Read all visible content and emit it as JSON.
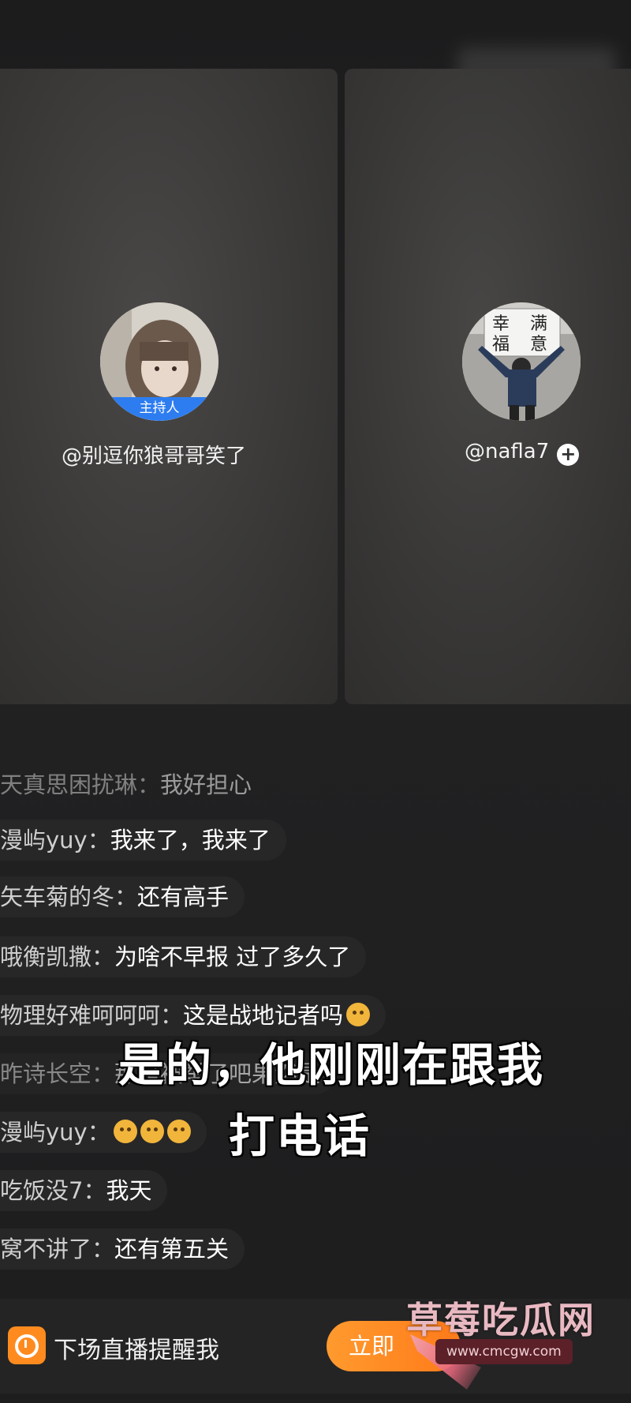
{
  "panels": {
    "left": {
      "name": "@别逗你狼哥哥笑了",
      "badge": "主持人"
    },
    "right": {
      "name": "@nafla7",
      "follow_icon": "plus-circle-icon",
      "sign_text": "幸满福意"
    }
  },
  "chat": [
    {
      "user": "天真思困扰琳：",
      "text": "我好担心"
    },
    {
      "user": "漫屿yuy：",
      "text": "我来了，我来了"
    },
    {
      "user": "矢车菊的冬：",
      "text": "还有高手"
    },
    {
      "user": "哦衡凯撒：",
      "text": "为啥不早报 过了多久了"
    },
    {
      "user": "物理好难呵呵呵：",
      "text": "这是战地记者吗"
    },
    {
      "user": "昨诗长空：",
      "text": "那是被举了吧果然是"
    },
    {
      "user": "漫屿yuy：",
      "text": ""
    },
    {
      "user": "吃饭没7：",
      "text": "我天"
    },
    {
      "user": "窝不讲了：",
      "text": "还有第五关"
    }
  ],
  "subtitle": {
    "line1": "是的，他刚刚在跟我",
    "line2": "打电话"
  },
  "bottom": {
    "remind_label": "下场直播提醒我",
    "button_label": "立即",
    "icon": "timer-icon"
  },
  "watermark": {
    "title": "草莓吃瓜网",
    "url": "www.cmcgw.com"
  },
  "colors": {
    "host_badge": "#2d7df0",
    "accent": "#ff8b1f",
    "background": "#1e1e1f"
  }
}
